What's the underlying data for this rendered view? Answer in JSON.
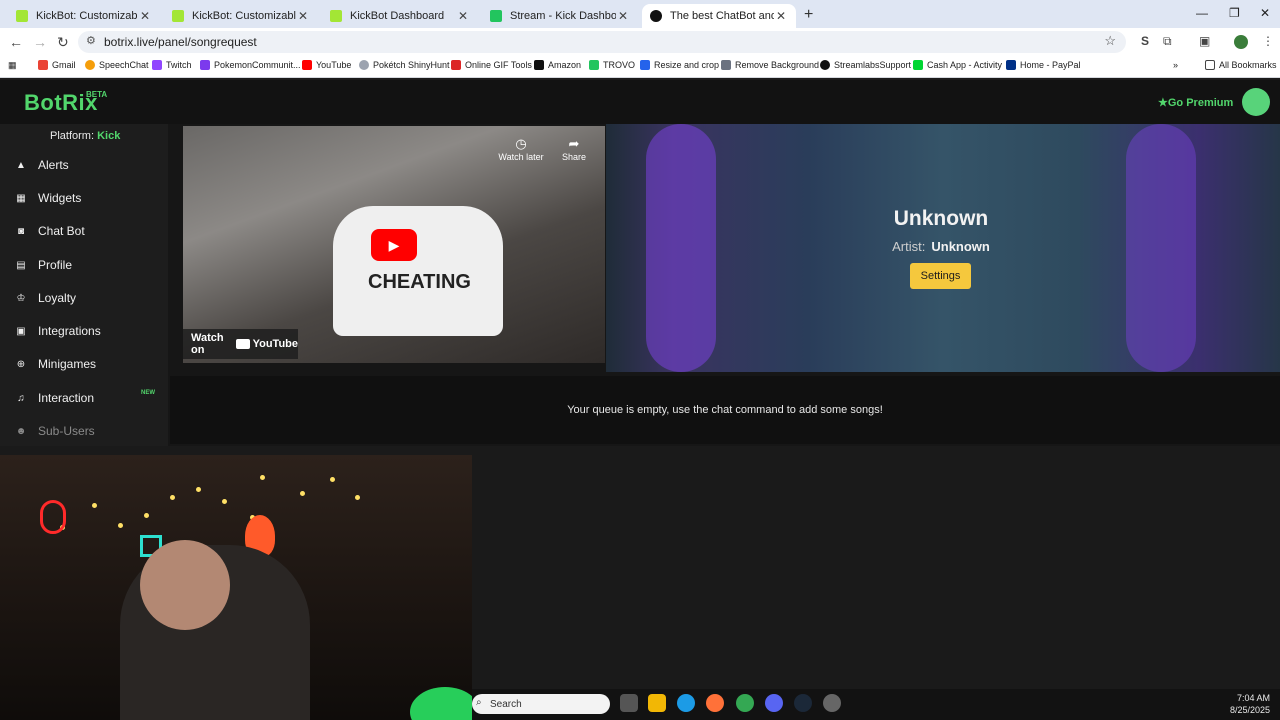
{
  "browser": {
    "tabs": [
      {
        "title": "KickBot: Customizable Chat Bot",
        "color": "#a3e635"
      },
      {
        "title": "KickBot: Customizable Chat Bot",
        "color": "#a3e635"
      },
      {
        "title": "KickBot Dashboard",
        "color": "#a3e635"
      },
      {
        "title": "Stream - Kick Dashboard",
        "color": "#22c55e"
      },
      {
        "title": "The best ChatBot and Widgets",
        "color": "#111111"
      }
    ],
    "new_tab": "+",
    "url": "botrix.live/panel/songrequest",
    "bookmarks": [
      {
        "label": "Gmail",
        "color": "#ea4335"
      },
      {
        "label": "SpeechChat",
        "color": "#f59e0b"
      },
      {
        "label": "Twitch",
        "color": "#9146ff"
      },
      {
        "label": "PokemonCommunit...",
        "color": "#7c3aed"
      },
      {
        "label": "YouTube",
        "color": "#ff0000"
      },
      {
        "label": "Pokétch ShinyHunt",
        "color": "#9ca3af"
      },
      {
        "label": "Online GIF Tools",
        "color": "#dc2626"
      },
      {
        "label": "Amazon",
        "color": "#111111"
      },
      {
        "label": "TROVO",
        "color": "#22c55e"
      },
      {
        "label": "Resize and crop",
        "color": "#2563eb"
      },
      {
        "label": "Remove Background",
        "color": "#6b7280"
      },
      {
        "label": "StreamlabsSupport",
        "color": "#111111"
      },
      {
        "label": "Cash App - Activity",
        "color": "#00d632"
      },
      {
        "label": "Home - PayPal",
        "color": "#003087"
      }
    ],
    "all_bookmarks": "All Bookmarks"
  },
  "app": {
    "logo": "BotRix",
    "beta": "BETA",
    "go_premium": "Go Premium",
    "platform_label": "Platform:",
    "platform_value": "Kick",
    "nav": [
      {
        "label": "Alerts",
        "icon": "warning-icon"
      },
      {
        "label": "Widgets",
        "icon": "grid-icon"
      },
      {
        "label": "Chat Bot",
        "icon": "robot-icon"
      },
      {
        "label": "Profile",
        "icon": "id-card-icon"
      },
      {
        "label": "Loyalty",
        "icon": "trophy-icon"
      },
      {
        "label": "Integrations",
        "icon": "plug-icon"
      },
      {
        "label": "Minigames",
        "icon": "gamepad-icon"
      },
      {
        "label": "Interaction",
        "icon": "music-icon",
        "badge": "NEW"
      },
      {
        "label": "Sub-Users",
        "icon": "users-icon"
      }
    ]
  },
  "player": {
    "song_title": "Unknown",
    "artist_label": "Artist:",
    "artist_value": "Unknown",
    "settings_label": "Settings",
    "watch_later": "Watch later",
    "share": "Share",
    "watch_on": "Watch on",
    "youtube": "YouTube",
    "shirt_text": "CHEATING"
  },
  "queue": {
    "empty_message": "Your queue is empty, use the chat command to add some songs!"
  },
  "taskbar": {
    "search_placeholder": "Search",
    "time": "7:04 AM",
    "date": "8/25/2025"
  },
  "colors": {
    "accent_green": "#52d66c",
    "settings_yellow": "#f5c83d",
    "yt_red": "#ff0000"
  }
}
